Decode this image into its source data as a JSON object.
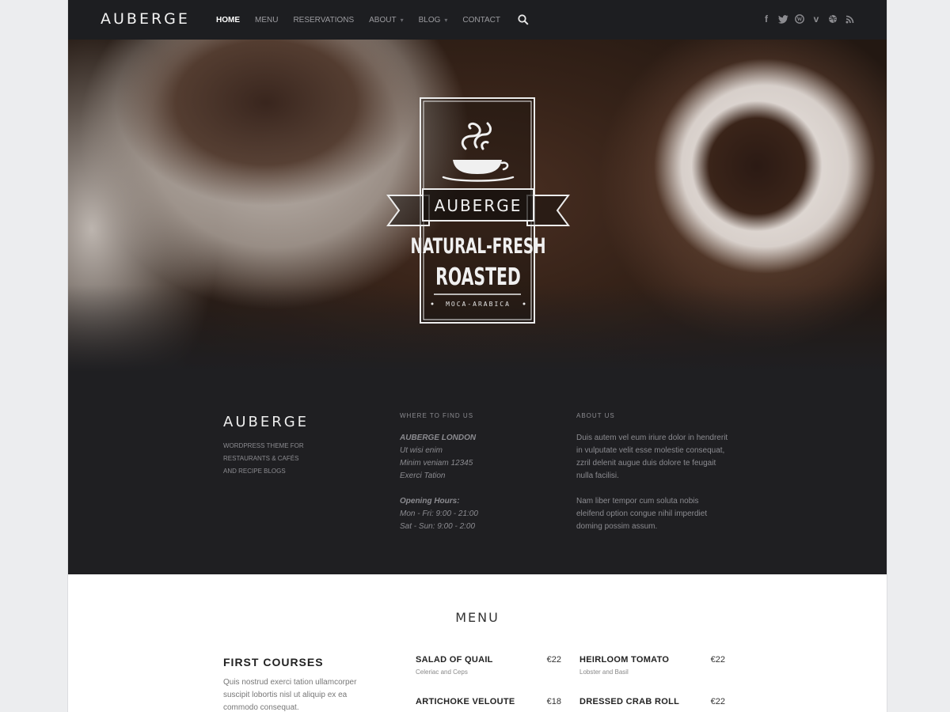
{
  "header": {
    "logo": "AUBERGE",
    "nav": [
      {
        "label": "HOME",
        "active": true,
        "dropdown": false
      },
      {
        "label": "MENU",
        "active": false,
        "dropdown": false
      },
      {
        "label": "RESERVATIONS",
        "active": false,
        "dropdown": false
      },
      {
        "label": "ABOUT",
        "active": false,
        "dropdown": true
      },
      {
        "label": "BLOG",
        "active": false,
        "dropdown": true
      },
      {
        "label": "CONTACT",
        "active": false,
        "dropdown": false
      }
    ],
    "search_icon": "search-icon",
    "social_icons": [
      "facebook-icon",
      "twitter-icon",
      "wordpress-icon",
      "vimeo-icon",
      "dribbble-icon",
      "rss-icon"
    ]
  },
  "hero": {
    "badge_brand": "AUBERGE",
    "badge_line1": "NATURAL-FRESH",
    "badge_line2": "ROASTED",
    "badge_small": "MOCA-ARABICA",
    "badge_icon": "steaming-coffee-cup-icon"
  },
  "info": {
    "brand_title": "AUBERGE",
    "brand_tagline": [
      "WORDPRESS THEME FOR",
      "RESTAURANTS & CAFÉS",
      "AND RECIPE BLOGS"
    ],
    "where_heading": "WHERE TO FIND US",
    "address": [
      "AUBERGE LONDON",
      "Ut wisi enim",
      "Minim veniam 12345",
      "Exerci Tation"
    ],
    "hours_heading": "Opening Hours:",
    "hours": [
      "Mon - Fri: 9:00 - 21:00",
      "Sat - Sun: 9:00 - 2:00"
    ],
    "about_heading": "ABOUT US",
    "about_p1": [
      "Duis autem vel eum iriure dolor in hendrerit",
      "in vulputate velit esse molestie consequat,",
      "zzril delenit augue duis dolore te feugait",
      "nulla facilisi."
    ],
    "about_p2": [
      "Nam liber tempor cum soluta nobis",
      "eleifend option congue nihil imperdiet",
      "doming possim assum."
    ]
  },
  "menu": {
    "title": "MENU",
    "first_courses_title": "FIRST COURSES",
    "first_courses_desc": [
      "Quis nostrud exerci tation ullamcorper",
      "suscipit lobortis nisl ut aliquip ex ea",
      "commodo consequat."
    ],
    "dishes": [
      {
        "name": "SALAD OF QUAIL",
        "price": "€22",
        "desc": "Celeriac and Ceps"
      },
      {
        "name": "HEIRLOOM TOMATO",
        "price": "€22",
        "desc": "Lobster and Basil"
      },
      {
        "name": "ARTICHOKE VELOUTE",
        "price": "€18",
        "desc": ""
      },
      {
        "name": "DRESSED CRAB ROLL",
        "price": "€22",
        "desc": ""
      }
    ]
  },
  "colors": {
    "dark_bg": "#1f1f22",
    "header_bg": "#1d1e21",
    "text_muted": "#8b8b90",
    "white": "#ffffff"
  }
}
